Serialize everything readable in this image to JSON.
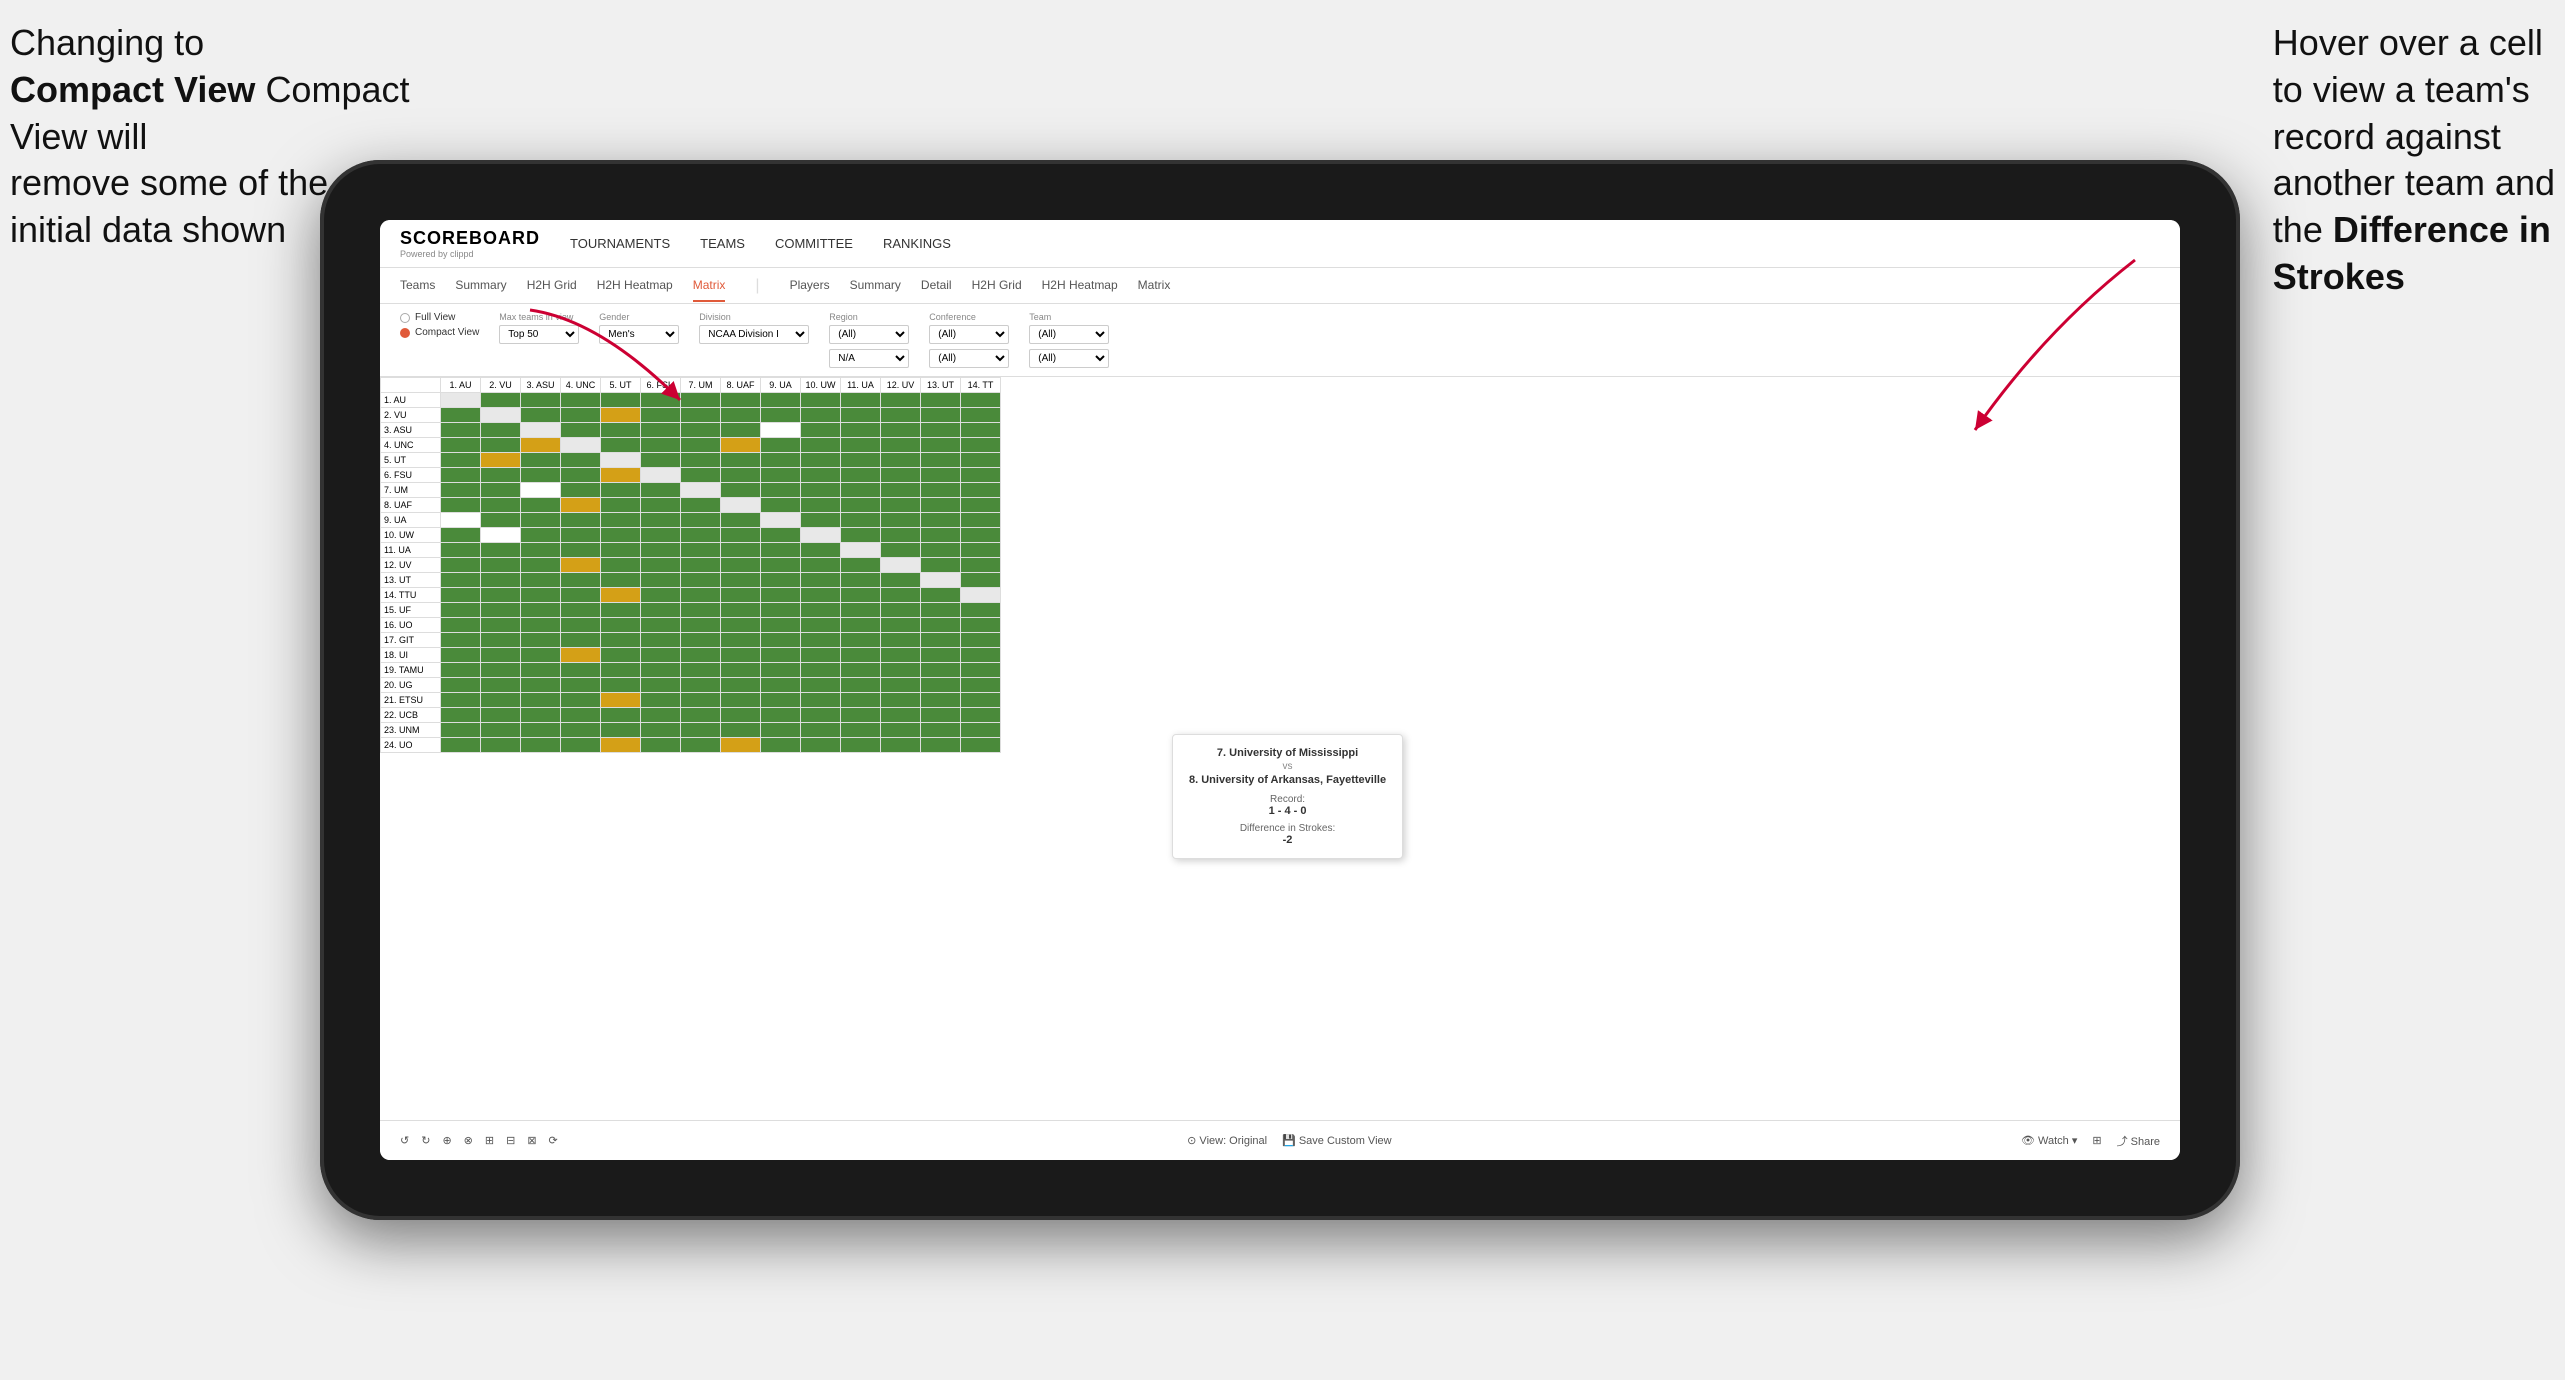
{
  "annotations": {
    "left": {
      "line1": "Changing to",
      "line2": "Compact View will",
      "line3": "remove some of the",
      "line4": "initial data shown"
    },
    "right": {
      "line1": "Hover over a cell",
      "line2": "to view a team's",
      "line3": "record against",
      "line4": "another team and",
      "line5": "the ",
      "line6": "Difference in",
      "line7": "Strokes"
    }
  },
  "nav": {
    "logo": "SCOREBOARD",
    "logo_sub": "Powered by clippd",
    "links": [
      "TOURNAMENTS",
      "TEAMS",
      "COMMITTEE",
      "RANKINGS"
    ]
  },
  "sub_tabs": {
    "groups": [
      {
        "tabs": [
          "Teams",
          "Summary",
          "H2H Grid",
          "H2H Heatmap",
          "Matrix"
        ]
      },
      {
        "tabs": [
          "Players",
          "Summary",
          "Detail",
          "H2H Grid",
          "H2H Heatmap",
          "Matrix"
        ]
      }
    ],
    "active": "Matrix"
  },
  "filters": {
    "view_options": [
      "Full View",
      "Compact View"
    ],
    "selected_view": "Compact View",
    "max_teams": {
      "label": "Max teams in view",
      "value": "Top 50"
    },
    "gender": {
      "label": "Gender",
      "value": "Men's"
    },
    "division": {
      "label": "Division",
      "value": "NCAA Division I"
    },
    "region": {
      "label": "Region",
      "value": "N/A"
    },
    "conference": {
      "label": "Conference",
      "value": "(All)"
    },
    "team": {
      "label": "Team",
      "value": "(All)"
    }
  },
  "column_headers": [
    "1. AU",
    "2. VU",
    "3. ASU",
    "4. UNC",
    "5. UT",
    "6. FSU",
    "7. UM",
    "8. UAF",
    "9. UA",
    "10. UW",
    "11. UA",
    "12. UV",
    "13. UT",
    "14. TT"
  ],
  "row_headers": [
    "1. AU",
    "2. VU",
    "3. ASU",
    "4. UNC",
    "5. UT",
    "6. FSU",
    "7. UM",
    "8. UAF",
    "9. UA",
    "10. UW",
    "11. UA",
    "12. UV",
    "13. UT",
    "14. TTU",
    "15. UF",
    "16. UO",
    "17. GIT",
    "18. UI",
    "19. TAMU",
    "20. UG",
    "21. ETSU",
    "22. UCB",
    "23. UNM",
    "24. UO"
  ],
  "tooltip": {
    "team1": "7. University of Mississippi",
    "vs": "vs",
    "team2": "8. University of Arkansas, Fayetteville",
    "record_label": "Record:",
    "record": "1 - 4 - 0",
    "strokes_label": "Difference in Strokes:",
    "strokes": "-2"
  },
  "toolbar": {
    "view_original": "View: Original",
    "save_custom": "Save Custom View",
    "watch": "Watch",
    "share": "Share"
  }
}
